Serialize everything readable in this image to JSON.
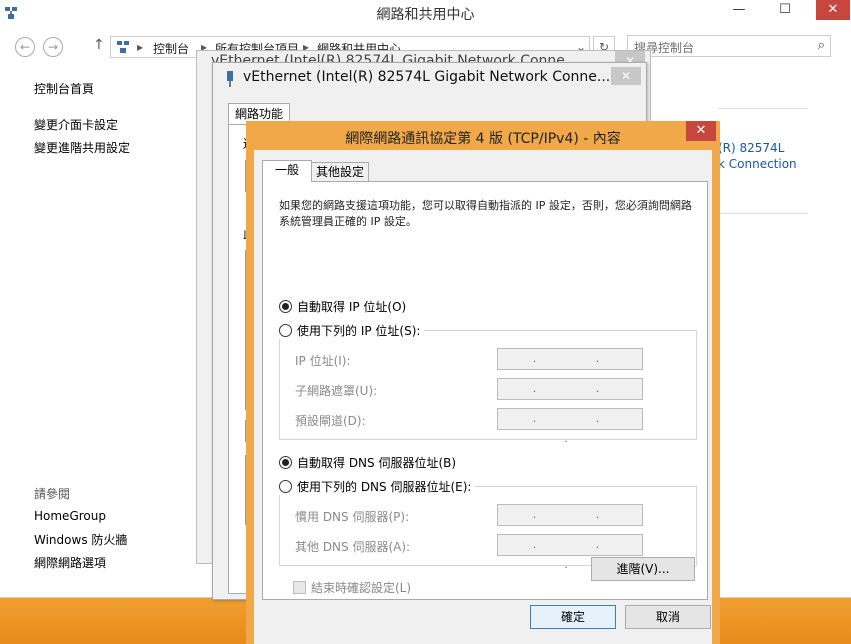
{
  "main_window": {
    "title": "網路和共用中心",
    "caption": {
      "minimize": "—",
      "maximize": "☐",
      "close": "✕"
    },
    "nav": {
      "back": "←",
      "forward": "→",
      "up": "↑",
      "refresh": "↻"
    },
    "breadcrumb": [
      "控制台",
      "所有控制台項目",
      "網路和共用中心"
    ],
    "search_placeholder": "搜尋控制台",
    "sidebar": {
      "items": [
        {
          "label": "控制台首頁"
        },
        {
          "label": "變更介面卡設定"
        },
        {
          "label": "變更進階共用設定"
        }
      ],
      "see_also_title": "請參閱",
      "see_also": [
        {
          "label": "HomeGroup"
        },
        {
          "label": "Windows 防火牆"
        },
        {
          "label": "網際網路選項"
        }
      ]
    },
    "right_adapter_line1": "(R) 82574L",
    "right_adapter_line2": "k Connection"
  },
  "status_window": {
    "title": "vEthernet (Intel(R) 82574L Gigabit Network Conne..."
  },
  "props_window": {
    "title": "vEthernet (Intel(R) 82574L Gigabit Network Conne...",
    "tab": "網路功能",
    "fragments": [
      "連",
      "此"
    ]
  },
  "dialog": {
    "title": "網際網路通訊協定第 4 版 (TCP/IPv4) - 內容",
    "tabs": {
      "general": "一般",
      "alternate": "其他設定"
    },
    "description": "如果您的網路支援這項功能，您可以取得自動指派的 IP 設定，否則，您必須詢問網路系統管理員正確的 IP 設定。",
    "ip_auto": "自動取得 IP 位址(O)",
    "ip_manual": "使用下列的 IP 位址(S):",
    "ip_fields": [
      {
        "label": "IP 位址(I):",
        "value": ". . ."
      },
      {
        "label": "子網路遮罩(U):",
        "value": ". . ."
      },
      {
        "label": "預設閘道(D):",
        "value": ". . ."
      }
    ],
    "dns_auto": "自動取得 DNS 伺服器位址(B)",
    "dns_manual": "使用下列的 DNS 伺服器位址(E):",
    "dns_fields": [
      {
        "label": "慣用 DNS 伺服器(P):",
        "value": ". . ."
      },
      {
        "label": "其他 DNS 伺服器(A):",
        "value": ". . ."
      }
    ],
    "validate_label": "結束時確認設定(L)",
    "advanced": "進階(V)...",
    "ok": "確定",
    "cancel": "取消",
    "selected_ip_mode": "auto",
    "selected_dns_mode": "auto"
  },
  "colors": {
    "accent_orange": "#f0a848",
    "close_red": "#c7463e",
    "link_blue": "#1a57a5"
  }
}
